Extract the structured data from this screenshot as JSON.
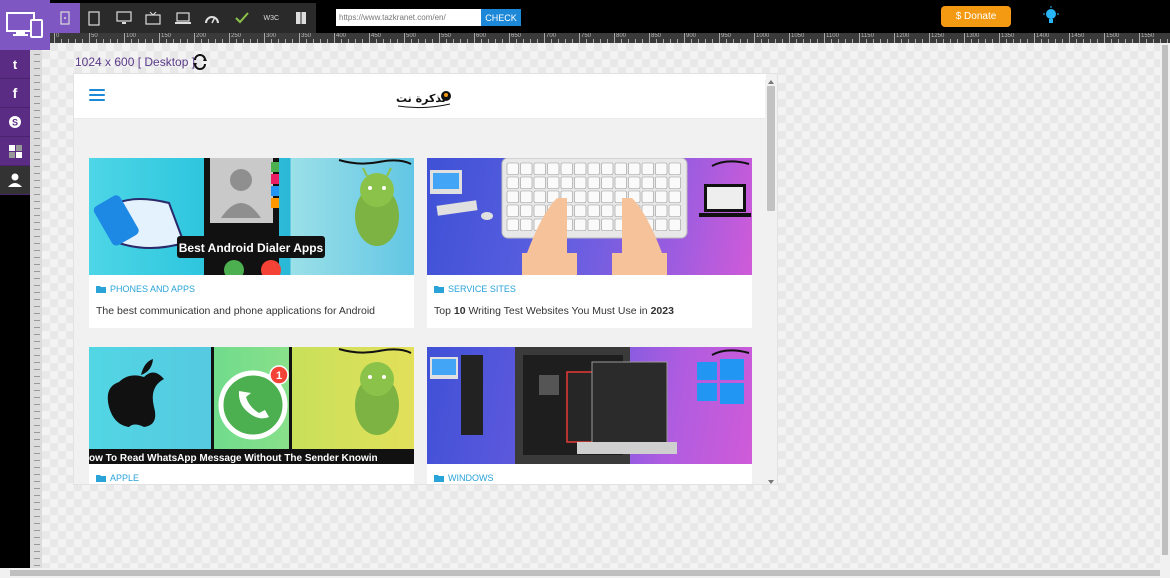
{
  "toolbar": {
    "url_value": "https://www.tazkranet.com/en/",
    "check_label": "CHECK",
    "donate_label": "$ Donate",
    "device_icons": [
      "tablet-portrait-icon",
      "tablet-landscape-icon",
      "desktop-icon",
      "tv-icon",
      "laptop-icon",
      "speed-icon",
      "validator-icon",
      "w3c-icon",
      "book-icon"
    ]
  },
  "sidebar": {
    "items": [
      "twitter-icon",
      "facebook-icon",
      "skype-icon",
      "delicious-icon",
      "profile-icon"
    ]
  },
  "viewport": {
    "size_label": "1024 x 600 [ Desktop ]"
  },
  "site": {
    "logo_text": "تذكرة نت"
  },
  "cards": [
    {
      "category": "PHONES AND APPS",
      "title": "The best communication and phone applications for Android",
      "thumb_text": "Best Android Dialer Apps"
    },
    {
      "category": "SERVICE SITES",
      "title_prefix": "Top ",
      "title_num": "10",
      "title_mid": " Writing Test Websites You Must Use in ",
      "title_year": "2023"
    },
    {
      "category": "APPLE",
      "thumb_text": "ow To Read WhatsApp Message Without The Sender Knowin",
      "badge": "1"
    },
    {
      "category": "WINDOWS"
    }
  ],
  "ruler": {
    "labels": [
      "0",
      "50",
      "100",
      "150",
      "200",
      "250",
      "300",
      "350",
      "400",
      "450",
      "500",
      "550",
      "600",
      "650",
      "700",
      "750",
      "800",
      "850",
      "900",
      "950",
      "1000",
      "1050",
      "1100",
      "1150",
      "1200",
      "1250",
      "1300",
      "1350",
      "1400",
      "1450",
      "1500",
      "1550"
    ]
  },
  "colors": {
    "accent": "#7e57c2",
    "link": "#2aa3d8",
    "donate": "#f39a12",
    "check": "#1e88d8"
  }
}
